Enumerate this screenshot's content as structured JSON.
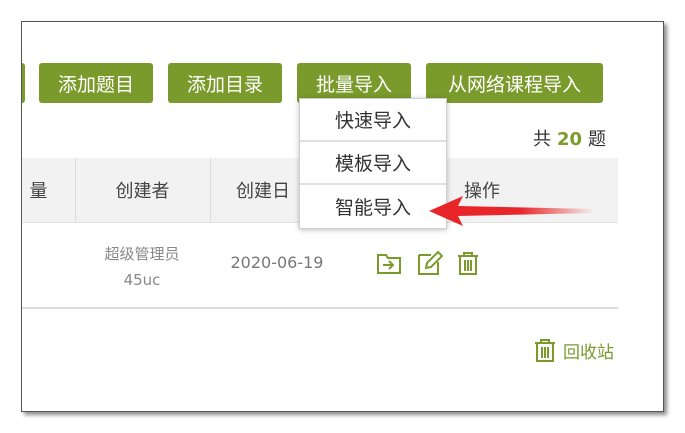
{
  "toolbar": {
    "add_question": "添加题目",
    "add_directory": "添加目录",
    "batch_import": "批量导入",
    "import_from_course": "从网络课程导入"
  },
  "total": {
    "prefix": "共",
    "count": "20",
    "suffix": "题"
  },
  "table": {
    "headers": [
      "量",
      "创建者",
      "创建日",
      "操作"
    ],
    "rows": [
      {
        "creator_line1": "超级管理员",
        "creator_line2": "45uc",
        "date": "2020-06-19"
      }
    ]
  },
  "dropdown": {
    "items": [
      "快速导入",
      "模板导入",
      "智能导入"
    ]
  },
  "recycle_bin": {
    "label": "回收站"
  },
  "colors": {
    "accent": "#7a9a2c",
    "arrow": "#e8262a"
  }
}
